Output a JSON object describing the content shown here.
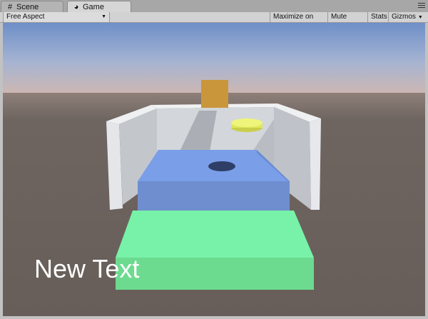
{
  "tabs": [
    {
      "label": "Scene",
      "icon": "grid-icon",
      "active": false
    },
    {
      "label": "Game",
      "icon": "game-pacman-icon",
      "active": true
    }
  ],
  "toolbar": {
    "aspect_value": "Free Aspect",
    "maximize_label": "Maximize on Play",
    "mute_label": "Mute audio",
    "stats_label": "Stats",
    "gizmos_label": "Gizmos"
  },
  "viewport": {
    "ui_text": "New Text",
    "colors": {
      "sky_top": "#6e8fc8",
      "horizon": "#cdb7b2",
      "ground": "#6b615c",
      "wall": "#d6d9dc",
      "blue_platform": "#7a9ee8",
      "green_platform": "#77f2a8",
      "orange_cube": "#c9963c",
      "yellow_disc": "#e6ef66"
    }
  }
}
